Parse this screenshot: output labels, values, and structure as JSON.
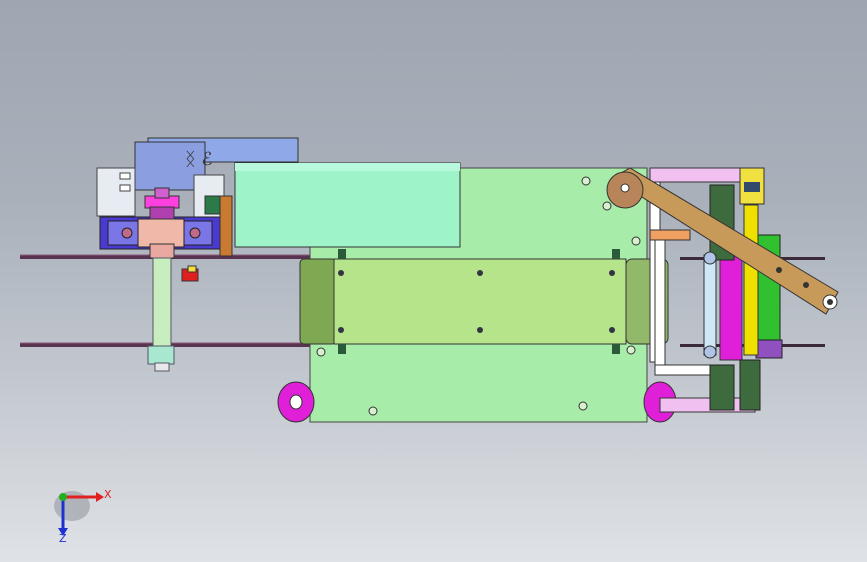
{
  "viewport": {
    "background_top": "#9fa6b1",
    "background_bottom": "#dfe2e6"
  },
  "triad": {
    "x_label": "X",
    "y_label": "Z",
    "x_color": "#e02020",
    "y_color": "#2030d0",
    "origin_color": "#20b020"
  },
  "colors": {
    "base_plate": "#a8ecaa",
    "front_block": "#b6e48a",
    "front_side": "#7fa852",
    "mint_box": "#9ef3c8",
    "purple_housing": "#6f6ae0",
    "magenta": "#e020d8",
    "arm_brown": "#c89a5a",
    "yellow_rod": "#f0e000",
    "dark_green": "#3d6b3d",
    "belt": "#4a2a4a"
  }
}
